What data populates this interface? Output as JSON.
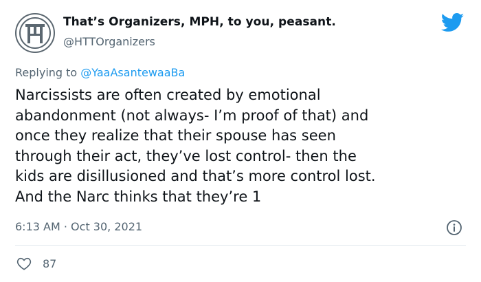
{
  "author": {
    "display_name": "That’s Organizers, MPH, to you, peasant.",
    "handle": "@HTTOrganizers",
    "avatar_icon": "ht-monogram-icon"
  },
  "brand_icon": "twitter-bird-icon",
  "reply": {
    "prefix": "Replying to",
    "mention": "@YaaAsantewaaBa"
  },
  "tweet": {
    "lines": [
      "Narcissists are often created by emotional",
      "abandonment (not always- I’m proof of that) and",
      "once they realize that their spouse has seen",
      "through their act, they’ve lost control- then the",
      "kids are disillusioned and that’s more control lost.",
      "And the Narc thinks that they’re 1"
    ]
  },
  "meta": {
    "time": "6:13 AM",
    "separator": "·",
    "date": "Oct 30, 2021",
    "info_icon": "info-icon"
  },
  "engagement": {
    "like_icon": "heart-icon",
    "like_count": "87"
  },
  "colors": {
    "text_primary": "#0f1419",
    "text_secondary": "#536471",
    "accent": "#1d9bf0",
    "divider": "#e1e8ed"
  }
}
